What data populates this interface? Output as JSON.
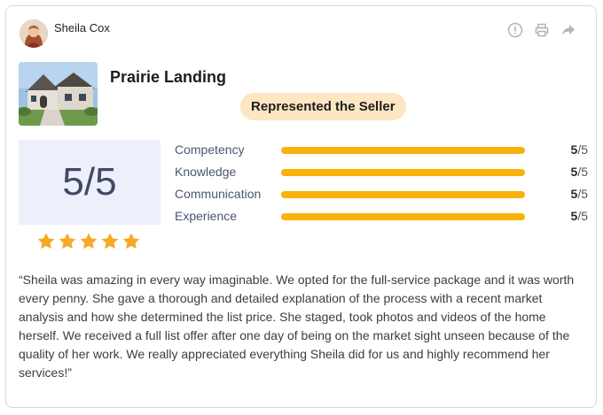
{
  "reviewer": {
    "name": "Sheila Cox"
  },
  "actions": [
    "info-icon",
    "print-icon",
    "share-icon"
  ],
  "property": {
    "name": "Prairie Landing",
    "role_badge": "Represented the Seller"
  },
  "overall": {
    "score_text": "5/5",
    "stars": 5
  },
  "ratings": [
    {
      "label": "Competency",
      "score": "5",
      "max": "/5",
      "fraction": 1.0
    },
    {
      "label": "Knowledge",
      "score": "5",
      "max": "/5",
      "fraction": 1.0
    },
    {
      "label": "Communication",
      "score": "5",
      "max": "/5",
      "fraction": 1.0
    },
    {
      "label": "Experience",
      "score": "5",
      "max": "/5",
      "fraction": 1.0
    }
  ],
  "review_text": "“Sheila was amazing in every way imaginable. We opted for the full-service package and it was worth every penny. She gave a thorough and detailed explanation of the process with a recent market analysis and how she determined the list price. She staged, took photos and videos of the home herself. We received a full list offer after one day of being on the market sight unseen because of the quality of her work. We really appreciated everything Sheila did for us and highly recommend her services!”",
  "colors": {
    "accent": "#f9b20a",
    "badge_bg": "#fde6c2",
    "score_bg": "#edf0fa"
  }
}
